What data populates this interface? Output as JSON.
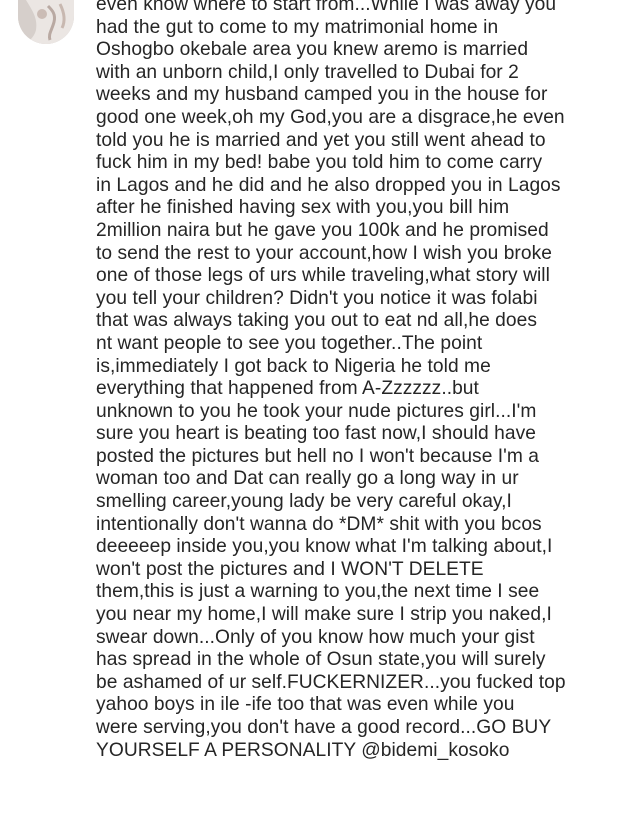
{
  "caption": {
    "lines": [
      "even know where to start from...While I was away you",
      "had the gut to come to my matrimonial home in",
      "Oshogbo okebale area you knew aremo is married",
      "with an unborn child,I only travelled to Dubai for 2",
      "weeks and my husband camped you in the house for",
      "good one week,oh my God,you are a disgrace,he even",
      "told you he is married and yet you still went ahead to",
      "fuck him in my bed! babe you told him to come carry",
      "in Lagos and he did and he also dropped you in Lagos",
      "after he finished having sex with you,you bill him",
      "2million naira but he gave you 100k and he promised",
      "to send the rest to your account,how I wish you broke",
      "one of those legs of urs while traveling,what story will",
      "you tell your children? Didn't you notice it was folabi",
      "that was always taking you out to eat nd all,he does",
      "nt want people to see you together..The point",
      "is,immediately I got back to Nigeria he told me",
      "everything that happened from A-Zzzzzz..but",
      "unknown to you he took your nude pictures girl...I'm",
      "sure you heart is beating too fast now,I should have",
      "posted the pictures but hell no I won't because I'm a",
      "woman too and Dat can really go a long way in ur",
      "smelling career,young lady be very careful okay,I",
      "intentionally don't wanna do *DM* shit with you bcos",
      "deeeeep inside you,you know what I'm talking about,I",
      "won't post the pictures and I WON'T DELETE",
      "them,this is just a warning to you,the next time I see",
      "you near my home,I will make sure I strip you naked,I",
      "swear down...Only of you know how much your gist",
      "has spread in the whole of Osun state,you will surely",
      "be ashamed of ur self.FUCKERNIZER...you fucked top",
      "yahoo boys in ile -ife too that was even while you",
      "were serving,you don't have a good record...GO BUY",
      "YOURSELF A PERSONALITY "
    ],
    "mention": "@bidemi_kosoko"
  },
  "colors": {
    "text": "#262626",
    "background": "#ffffff"
  },
  "icons": {
    "avatar": "profile-avatar"
  }
}
